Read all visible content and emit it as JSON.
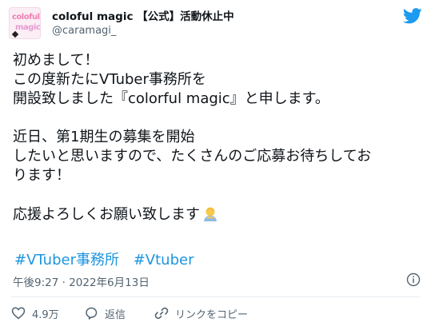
{
  "header": {
    "avatar_text_line1": "coloful",
    "avatar_text_line2": "magic",
    "display_name": "coloful magic 【公式】活動休止中",
    "handle": "@caramagi_"
  },
  "tweet": {
    "lines": [
      "初めまして！",
      "この度新たにVTuber事務所を",
      "開設致しました『colorful magic』と申します。",
      "",
      "近日、第1期生の募集を開始",
      "したいと思いますので、たくさんのご応募お待ちしてお",
      "ります！",
      "",
      "応援よろしくお願い致します"
    ],
    "hashtags": [
      "#VTuber事務所",
      "#Vtuber"
    ],
    "timestamp": "午後9:27 · 2022年6月13日"
  },
  "actions": {
    "likes": "4.9万",
    "reply": "返信",
    "copy_link": "リンクをコピー"
  },
  "colors": {
    "twitter_blue": "#1d9bf0",
    "hashtag": "#1b95e0",
    "secondary_text": "#536471",
    "like_red": "#e0245e"
  },
  "icons": {
    "logo": "twitter-bird-icon",
    "info": "info-icon",
    "like": "heart-icon",
    "reply": "speech-bubble-icon",
    "copy": "link-icon",
    "emoji": "person-bowing-emoji"
  }
}
